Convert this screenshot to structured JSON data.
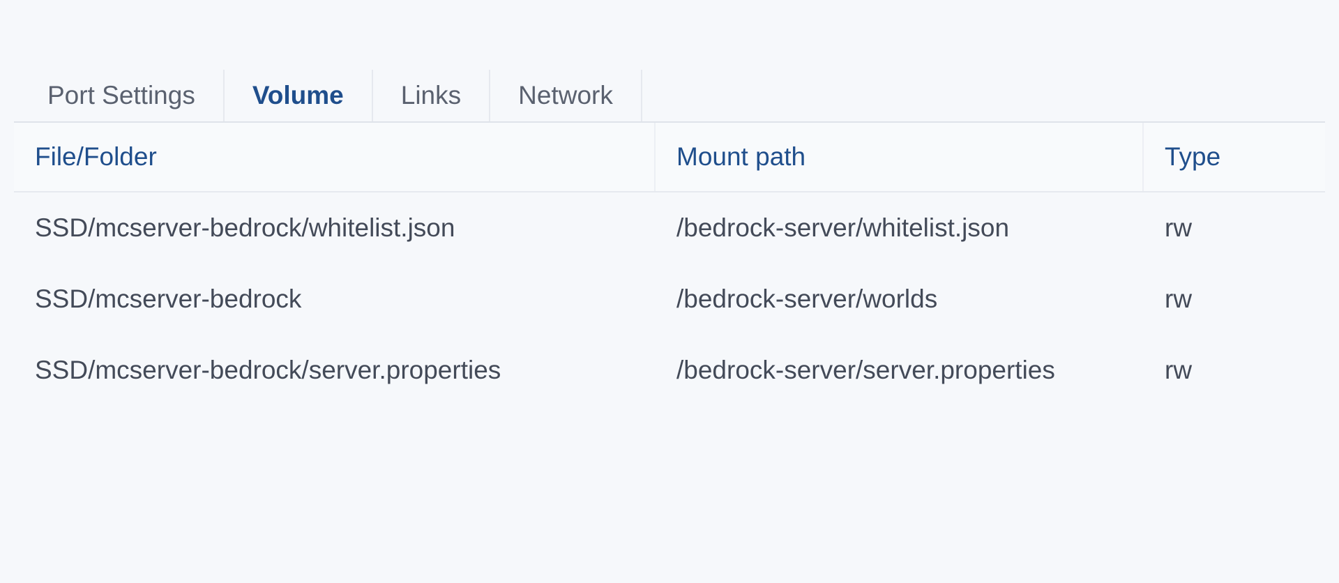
{
  "tabs": [
    {
      "label": "Port Settings",
      "active": false
    },
    {
      "label": "Volume",
      "active": true
    },
    {
      "label": "Links",
      "active": false
    },
    {
      "label": "Network",
      "active": false
    }
  ],
  "columns": {
    "file": "File/Folder",
    "mount": "Mount path",
    "type": "Type"
  },
  "rows": [
    {
      "file": "SSD/mcserver-bedrock/whitelist.json",
      "mount": "/bedrock-server/whitelist.json",
      "type": "rw"
    },
    {
      "file": "SSD/mcserver-bedrock",
      "mount": "/bedrock-server/worlds",
      "type": "rw"
    },
    {
      "file": "SSD/mcserver-bedrock/server.properties",
      "mount": "/bedrock-server/server.properties",
      "type": "rw"
    }
  ]
}
